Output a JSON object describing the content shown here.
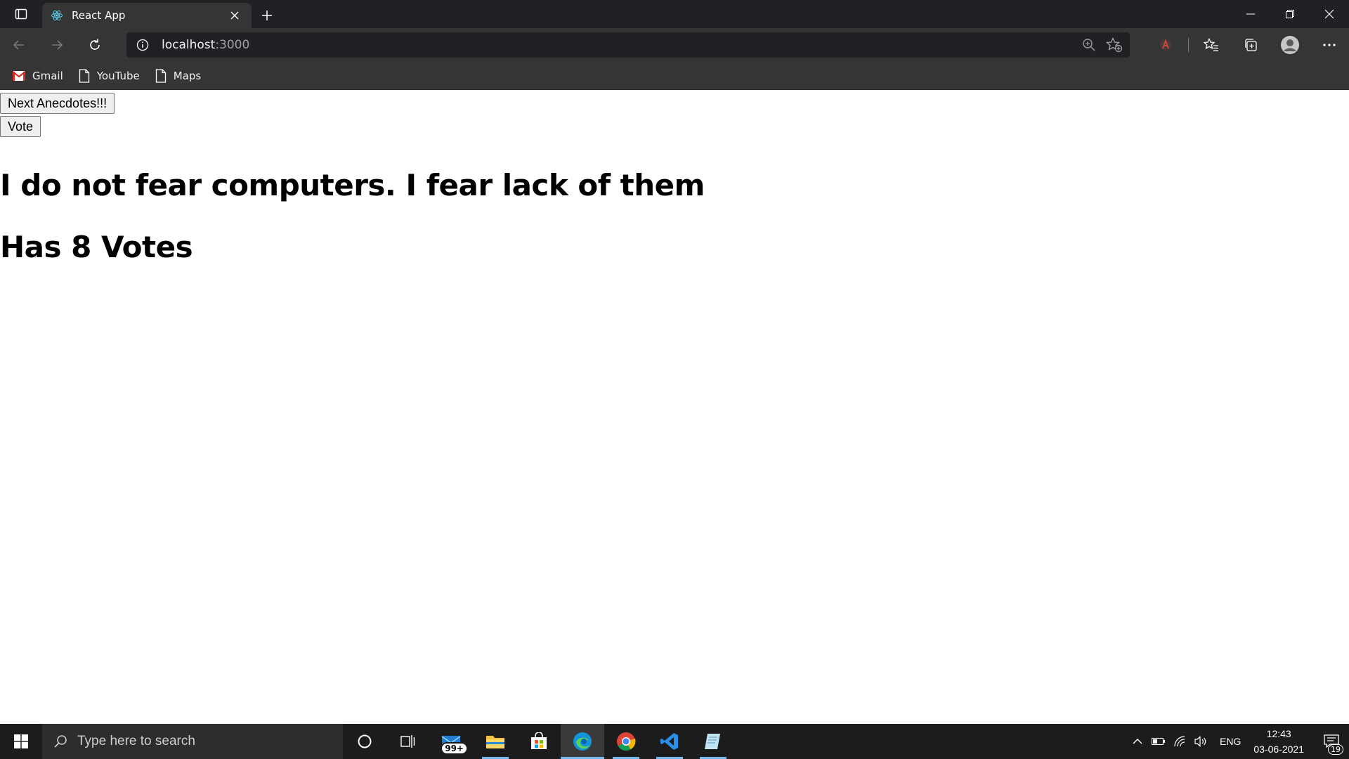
{
  "browser": {
    "tab": {
      "title": "React App",
      "icon": "react-logo-icon"
    },
    "address": {
      "host": "localhost",
      "port": ":3000"
    },
    "bookmarks": [
      {
        "label": "Gmail",
        "icon": "gmail-icon"
      },
      {
        "label": "YouTube",
        "icon": "page-icon"
      },
      {
        "label": "Maps",
        "icon": "page-icon"
      }
    ]
  },
  "app": {
    "next_button": "Next Anecdotes!!!",
    "vote_button": "Vote",
    "anecdote": "I do not fear computers. I fear lack of them",
    "votes_text": "Has 8 Votes"
  },
  "taskbar": {
    "search_placeholder": "Type here to search",
    "mail_badge": "99+",
    "language": "ENG",
    "time": "12:43",
    "date": "03-06-2021",
    "notification_count": "19"
  },
  "colors": {
    "chrome_dark": "#202124",
    "chrome": "#353535",
    "taskbar": "#1c1c1c",
    "accent": "#76b9ed"
  }
}
